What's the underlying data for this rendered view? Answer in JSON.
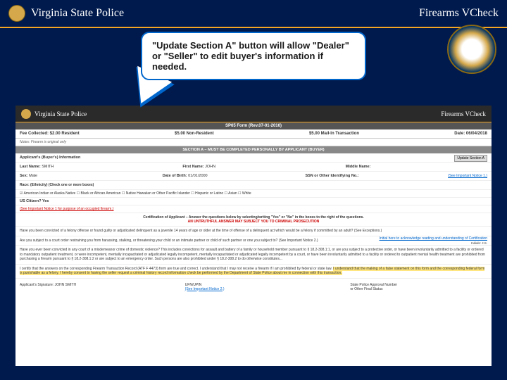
{
  "header": {
    "title": "Virginia State Police",
    "right": "Firearms VCheck"
  },
  "callout": {
    "text": "\"Update Section A\" button will allow \"Dealer\" or \"Seller\" to edit buyer's information if needed."
  },
  "form": {
    "header_title": "Virginia State Police",
    "header_right": "Firearms VCheck",
    "sp65_bar": "SP65 Form (Rev.07-01-2016)",
    "fees": {
      "resident": "Fee Collected: $2.00 Resident",
      "nonresident": "$5.00 Non-Resident",
      "mailin": "$5.00 Mail-In Transaction",
      "date": "Date: 06/04/2018"
    },
    "notes": "Notes: Firearm is original only",
    "update_btn": "Update Section A",
    "section_a_bar": "SECTION A – MUST BE COMPLETED PERSONALLY BY APPLICANT (BUYER)",
    "applicant_header": "Applicant's (Buyer's) Information",
    "name": {
      "last_label": "Last Name:",
      "last_value": "SMITH",
      "first_label": "First Name:",
      "first_value": "JOHN",
      "middle_label": "Middle Name:"
    },
    "row2": {
      "sex_label": "Sex:",
      "sex_value": "Male",
      "dob_label": "Date of Birth:",
      "dob_value": "01/01/2000",
      "ssn_label": "SSN or Other Identifying No.:",
      "notice_link": "(See Important Notice 1.)"
    },
    "race_label": "Race: (Ethnicity) (Check one or more boxes)",
    "race_options": "☑ American Indian or Alaska Native  ☐ Black or African American  ☐ Native Hawaiian or Other Pacific Islander  ☐ Hispanic or Latino  ☐ Asian  ☐ White",
    "citizen": "US Citizen? Yes",
    "occupied_link": "(See Important Notice 1 for purpose of an occupied firearm.)",
    "cert_line1": "Certification of Applicant – Answer the questions below by selecting/writing \"Yes\" or \"No\" in the boxes to the right of the questions.",
    "cert_line2": "AN UNTRUTHFUL ANSWER MAY SUBJECT YOU TO CRIMINAL PROSECUTION",
    "q1": "Have you been convicted of a felony offense or found guilty or adjudicated delinquent as a juvenile 14 years of age or older at the time of offense of a delinquent act which would be a felony if committed by an adult? (See Exceptions.)",
    "q1_right": "Initial here to acknowledge reading and understanding of Certification",
    "q1_init": "Initials: J.S.",
    "q2": "Are you subject to a court order restraining you from harassing, stalking, or threatening your child or an intimate partner or child of such partner or one you subject to? (See Important Notice 2.)",
    "q3": "Have you ever been convicted in any court of a misdemeanor crime of domestic violence? This includes convictions for assault and battery of a family or household member pursuant to § 18.2-308.1:1, or are you subject to a protective order, or have been involuntarily admitted to a facility or ordered to mandatory outpatient treatment, or were incompetent, mentally incapacitated or adjudicated legally incompetent, mentally incapacitated or adjudicated legally incompetent by a court, or have been involuntarily admitted to a facility or ordered to outpatient mental health treatment are prohibited from purchasing a firearm pursuant to § 18.2-308.1:2 or are subject to an emergency order. Such persons are also prohibited under § 18.2-308.2 to do otherwise constitutes...",
    "q4_prefix": "I certify that the answers on the corresponding Firearm Transaction Record (ATF F 4473) form are true and correct. I understand that I may not receive a firearm if I am prohibited by federal or state law. ",
    "q4_yellow": "I understand that the making of a false statement on this form and the corresponding federal form is punishable as a felony. I hereby consent to having the seller request a criminal history record information check be performed by the Department of State Police about me in connection with this transaction.",
    "sig": {
      "applicant_label": "Applicant's Signature:",
      "applicant_value": "JOHN SMITH",
      "ufn_label": "UFN/UPIN",
      "notice_link": "(See Important Notice 2.)",
      "approval_label": "State Police Approval Number",
      "approval_sub": "or Other Final Status"
    }
  }
}
